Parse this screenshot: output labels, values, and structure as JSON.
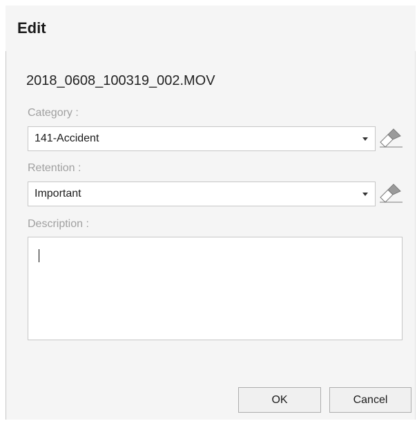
{
  "dialog": {
    "title": "Edit",
    "filename": "2018_0608_100319_002.MOV"
  },
  "category": {
    "label": "Category :",
    "value": "141-Accident"
  },
  "retention": {
    "label": "Retention :",
    "value": "Important"
  },
  "description": {
    "label": "Description :",
    "value": ""
  },
  "buttons": {
    "ok": "OK",
    "cancel": "Cancel"
  },
  "icons": {
    "dropdown": "chevron-down-icon",
    "clear": "eraser-icon"
  }
}
